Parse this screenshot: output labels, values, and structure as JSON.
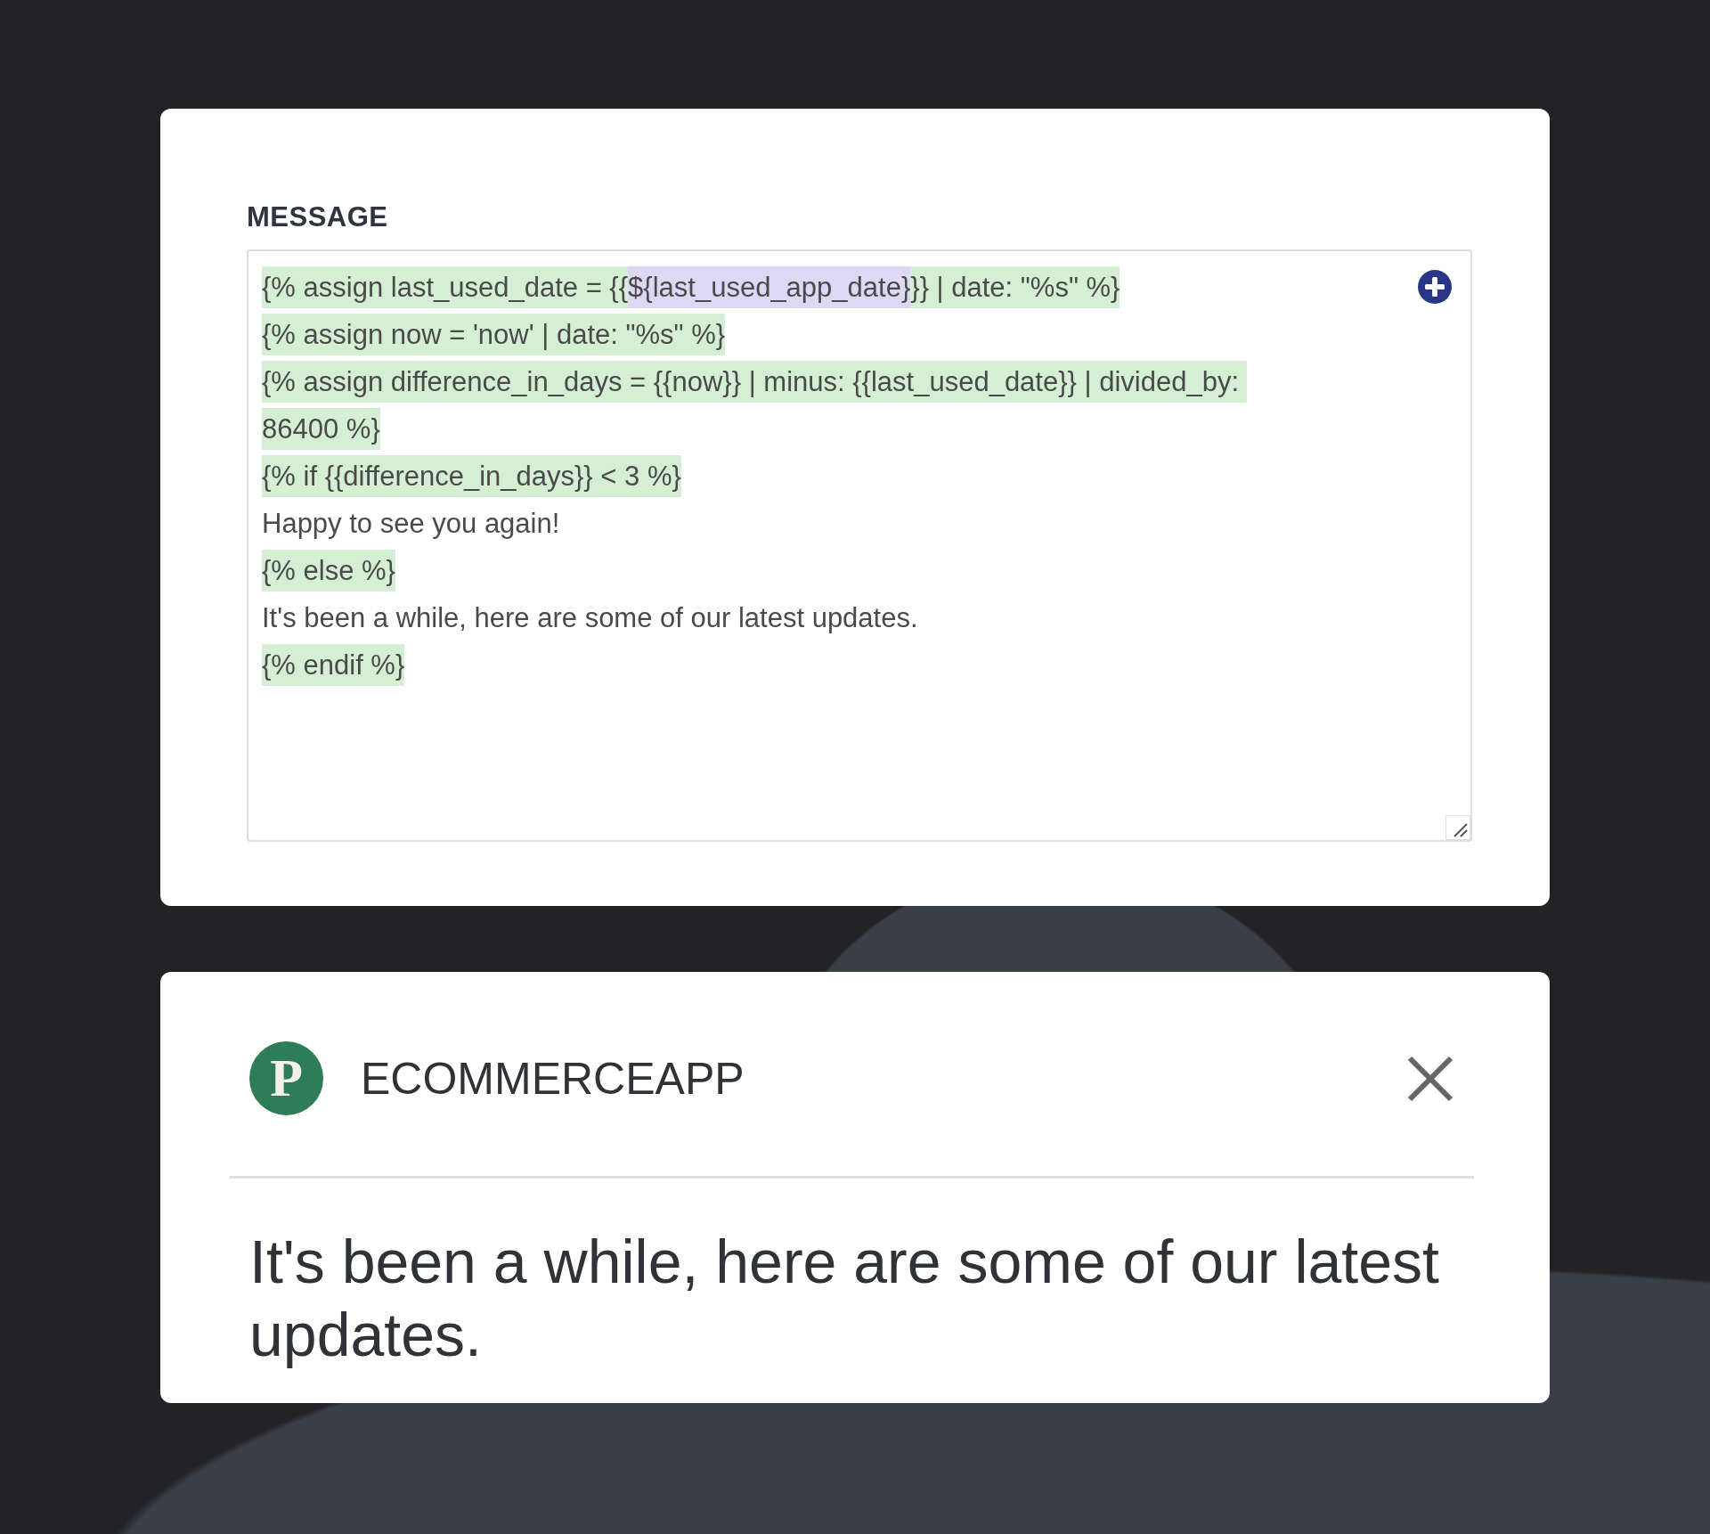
{
  "editor": {
    "label": "MESSAGE",
    "lines": [
      {
        "segments": [
          {
            "kind": "tag",
            "text": "{% assign last_used_date = {{"
          },
          {
            "kind": "variable",
            "text": "${last_used_app_date}"
          },
          {
            "kind": "tag",
            "text": "}} | date: \"%s\" %}"
          }
        ]
      },
      {
        "segments": [
          {
            "kind": "tag",
            "text": "{% assign now = 'now' | date: \"%s\" %}"
          }
        ]
      },
      {
        "segments": [
          {
            "kind": "tag",
            "text": "{% assign difference_in_days = {{now}} | minus: {{last_used_date}} | divided_by: "
          }
        ]
      },
      {
        "segments": [
          {
            "kind": "tag",
            "text": "86400 %}"
          }
        ]
      },
      {
        "segments": [
          {
            "kind": "tag",
            "text": "{% if {{difference_in_days}} < 3 %}"
          }
        ]
      },
      {
        "segments": [
          {
            "kind": "plain",
            "text": "Happy to see you again!"
          }
        ]
      },
      {
        "segments": [
          {
            "kind": "tag",
            "text": "{% else %}"
          }
        ]
      },
      {
        "segments": [
          {
            "kind": "plain",
            "text": "It's been a while, here are some of our latest updates."
          }
        ]
      },
      {
        "segments": [
          {
            "kind": "tag",
            "text": "{% endif %}"
          }
        ]
      }
    ]
  },
  "notification": {
    "logo_letter": "P",
    "app_name": "ECOMMERCEAPP",
    "body": "It's been a while, here are some of our latest updates."
  }
}
